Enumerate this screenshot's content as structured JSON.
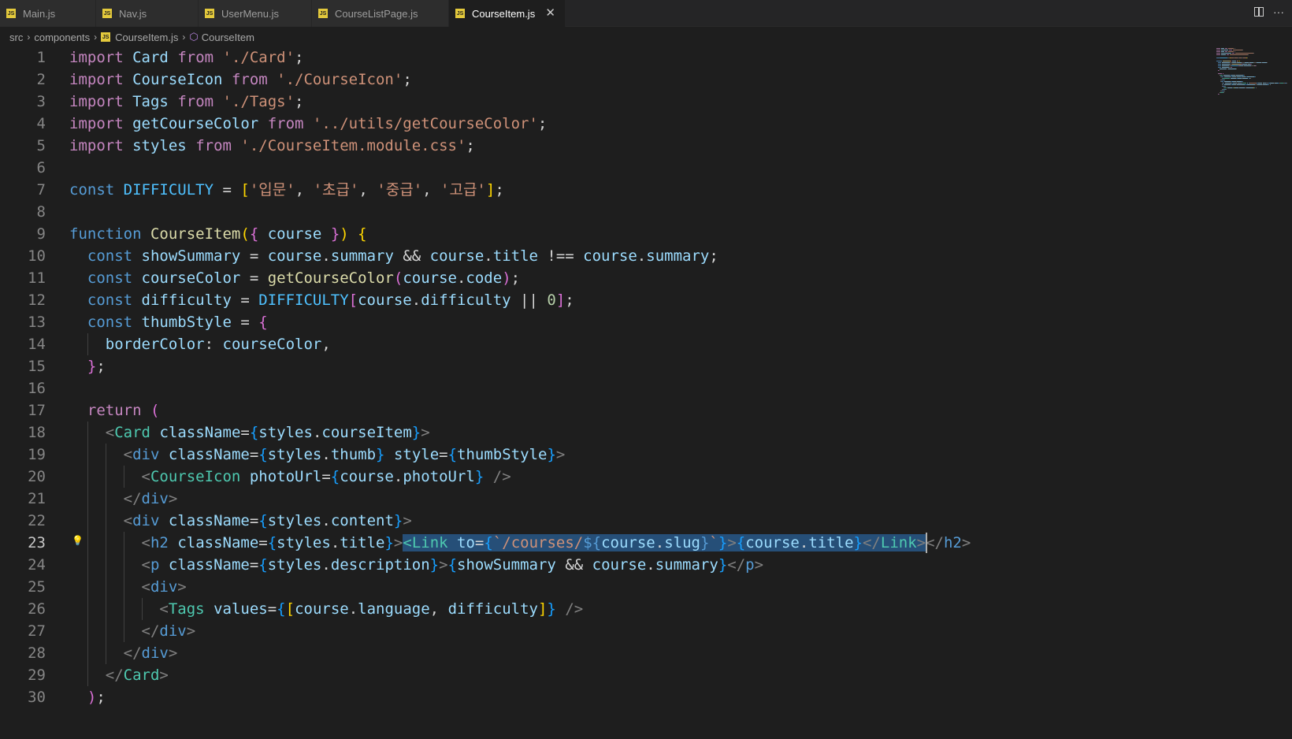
{
  "tabs": [
    {
      "label": "Main.js",
      "icon": "js-file-icon",
      "active": false
    },
    {
      "label": "Nav.js",
      "icon": "js-file-icon",
      "active": false
    },
    {
      "label": "UserMenu.js",
      "icon": "js-file-icon",
      "active": false
    },
    {
      "label": "CourseListPage.js",
      "icon": "js-file-icon",
      "active": false
    },
    {
      "label": "CourseItem.js",
      "icon": "js-file-icon",
      "active": true
    }
  ],
  "tab_icon_text": "JS",
  "close_glyph": "✕",
  "more_glyph": "···",
  "breadcrumb": {
    "items": [
      "src",
      "components",
      "CourseItem.js",
      "CourseItem"
    ],
    "sep": "›"
  },
  "active_line": 23,
  "colors": {
    "background": "#1e1e1e",
    "keyword": "#c586c0",
    "storage": "#569cd6",
    "function": "#dcdcaa",
    "variable": "#9cdcfe",
    "string": "#ce9178",
    "component": "#4ec9b0",
    "selection": "#264f78"
  },
  "code_lines": [
    {
      "n": 1,
      "tokens": [
        [
          "kw",
          "import"
        ],
        [
          "op",
          " "
        ],
        [
          "var",
          "Card"
        ],
        [
          "op",
          " "
        ],
        [
          "kw",
          "from"
        ],
        [
          "op",
          " "
        ],
        [
          "str",
          "'./Card'"
        ],
        [
          "op",
          ";"
        ]
      ]
    },
    {
      "n": 2,
      "tokens": [
        [
          "kw",
          "import"
        ],
        [
          "op",
          " "
        ],
        [
          "var",
          "CourseIcon"
        ],
        [
          "op",
          " "
        ],
        [
          "kw",
          "from"
        ],
        [
          "op",
          " "
        ],
        [
          "str",
          "'./CourseIcon'"
        ],
        [
          "op",
          ";"
        ]
      ]
    },
    {
      "n": 3,
      "tokens": [
        [
          "kw",
          "import"
        ],
        [
          "op",
          " "
        ],
        [
          "var",
          "Tags"
        ],
        [
          "op",
          " "
        ],
        [
          "kw",
          "from"
        ],
        [
          "op",
          " "
        ],
        [
          "str",
          "'./Tags'"
        ],
        [
          "op",
          ";"
        ]
      ]
    },
    {
      "n": 4,
      "tokens": [
        [
          "kw",
          "import"
        ],
        [
          "op",
          " "
        ],
        [
          "var",
          "getCourseColor"
        ],
        [
          "op",
          " "
        ],
        [
          "kw",
          "from"
        ],
        [
          "op",
          " "
        ],
        [
          "str",
          "'../utils/getCourseColor'"
        ],
        [
          "op",
          ";"
        ]
      ]
    },
    {
      "n": 5,
      "tokens": [
        [
          "kw",
          "import"
        ],
        [
          "op",
          " "
        ],
        [
          "var",
          "styles"
        ],
        [
          "op",
          " "
        ],
        [
          "kw",
          "from"
        ],
        [
          "op",
          " "
        ],
        [
          "str",
          "'./CourseItem.module.css'"
        ],
        [
          "op",
          ";"
        ]
      ]
    },
    {
      "n": 6,
      "tokens": []
    },
    {
      "n": 7,
      "tokens": [
        [
          "st",
          "const"
        ],
        [
          "op",
          " "
        ],
        [
          "con",
          "DIFFICULTY"
        ],
        [
          "op",
          " = "
        ],
        [
          "b1",
          "["
        ],
        [
          "str",
          "'입문'"
        ],
        [
          "op",
          ", "
        ],
        [
          "str",
          "'초급'"
        ],
        [
          "op",
          ", "
        ],
        [
          "str",
          "'중급'"
        ],
        [
          "op",
          ", "
        ],
        [
          "str",
          "'고급'"
        ],
        [
          "b1",
          "]"
        ],
        [
          "op",
          ";"
        ]
      ]
    },
    {
      "n": 8,
      "tokens": []
    },
    {
      "n": 9,
      "tokens": [
        [
          "st",
          "function"
        ],
        [
          "op",
          " "
        ],
        [
          "fn",
          "CourseItem"
        ],
        [
          "b1",
          "("
        ],
        [
          "b2",
          "{"
        ],
        [
          "op",
          " "
        ],
        [
          "var",
          "course"
        ],
        [
          "op",
          " "
        ],
        [
          "b2",
          "}"
        ],
        [
          "b1",
          ")"
        ],
        [
          "op",
          " "
        ],
        [
          "b1",
          "{"
        ]
      ]
    },
    {
      "n": 10,
      "tokens": [
        [
          "op",
          "  "
        ],
        [
          "st",
          "const"
        ],
        [
          "op",
          " "
        ],
        [
          "var",
          "showSummary"
        ],
        [
          "op",
          " = "
        ],
        [
          "var",
          "course"
        ],
        [
          "op",
          "."
        ],
        [
          "var",
          "summary"
        ],
        [
          "op",
          " && "
        ],
        [
          "var",
          "course"
        ],
        [
          "op",
          "."
        ],
        [
          "var",
          "title"
        ],
        [
          "op",
          " !== "
        ],
        [
          "var",
          "course"
        ],
        [
          "op",
          "."
        ],
        [
          "var",
          "summary"
        ],
        [
          "op",
          ";"
        ]
      ]
    },
    {
      "n": 11,
      "tokens": [
        [
          "op",
          "  "
        ],
        [
          "st",
          "const"
        ],
        [
          "op",
          " "
        ],
        [
          "var",
          "courseColor"
        ],
        [
          "op",
          " = "
        ],
        [
          "fn",
          "getCourseColor"
        ],
        [
          "b2",
          "("
        ],
        [
          "var",
          "course"
        ],
        [
          "op",
          "."
        ],
        [
          "var",
          "code"
        ],
        [
          "b2",
          ")"
        ],
        [
          "op",
          ";"
        ]
      ]
    },
    {
      "n": 12,
      "tokens": [
        [
          "op",
          "  "
        ],
        [
          "st",
          "const"
        ],
        [
          "op",
          " "
        ],
        [
          "var",
          "difficulty"
        ],
        [
          "op",
          " = "
        ],
        [
          "con",
          "DIFFICULTY"
        ],
        [
          "b2",
          "["
        ],
        [
          "var",
          "course"
        ],
        [
          "op",
          "."
        ],
        [
          "var",
          "difficulty"
        ],
        [
          "op",
          " || "
        ],
        [
          "num",
          "0"
        ],
        [
          "b2",
          "]"
        ],
        [
          "op",
          ";"
        ]
      ]
    },
    {
      "n": 13,
      "tokens": [
        [
          "op",
          "  "
        ],
        [
          "st",
          "const"
        ],
        [
          "op",
          " "
        ],
        [
          "var",
          "thumbStyle"
        ],
        [
          "op",
          " = "
        ],
        [
          "b2",
          "{"
        ]
      ]
    },
    {
      "n": 14,
      "tokens": [
        [
          "op",
          "    "
        ],
        [
          "var",
          "borderColor"
        ],
        [
          "op",
          ": "
        ],
        [
          "var",
          "courseColor"
        ],
        [
          "op",
          ","
        ]
      ]
    },
    {
      "n": 15,
      "tokens": [
        [
          "op",
          "  "
        ],
        [
          "b2",
          "}"
        ],
        [
          "op",
          ";"
        ]
      ]
    },
    {
      "n": 16,
      "tokens": []
    },
    {
      "n": 17,
      "tokens": [
        [
          "op",
          "  "
        ],
        [
          "kw",
          "return"
        ],
        [
          "op",
          " "
        ],
        [
          "b2",
          "("
        ]
      ]
    },
    {
      "n": 18,
      "tokens": [
        [
          "op",
          "    "
        ],
        [
          "tagp",
          "<"
        ],
        [
          "comp",
          "Card"
        ],
        [
          "op",
          " "
        ],
        [
          "attr",
          "className"
        ],
        [
          "op",
          "="
        ],
        [
          "b3",
          "{"
        ],
        [
          "var",
          "styles"
        ],
        [
          "op",
          "."
        ],
        [
          "var",
          "courseItem"
        ],
        [
          "b3",
          "}"
        ],
        [
          "tagp",
          ">"
        ]
      ]
    },
    {
      "n": 19,
      "tokens": [
        [
          "op",
          "      "
        ],
        [
          "tagp",
          "<"
        ],
        [
          "htag",
          "div"
        ],
        [
          "op",
          " "
        ],
        [
          "attr",
          "className"
        ],
        [
          "op",
          "="
        ],
        [
          "b3",
          "{"
        ],
        [
          "var",
          "styles"
        ],
        [
          "op",
          "."
        ],
        [
          "var",
          "thumb"
        ],
        [
          "b3",
          "}"
        ],
        [
          "op",
          " "
        ],
        [
          "attr",
          "style"
        ],
        [
          "op",
          "="
        ],
        [
          "b3",
          "{"
        ],
        [
          "var",
          "thumbStyle"
        ],
        [
          "b3",
          "}"
        ],
        [
          "tagp",
          ">"
        ]
      ]
    },
    {
      "n": 20,
      "tokens": [
        [
          "op",
          "        "
        ],
        [
          "tagp",
          "<"
        ],
        [
          "comp",
          "CourseIcon"
        ],
        [
          "op",
          " "
        ],
        [
          "attr",
          "photoUrl"
        ],
        [
          "op",
          "="
        ],
        [
          "b3",
          "{"
        ],
        [
          "var",
          "course"
        ],
        [
          "op",
          "."
        ],
        [
          "var",
          "photoUrl"
        ],
        [
          "b3",
          "}"
        ],
        [
          "op",
          " "
        ],
        [
          "tagp",
          "/>"
        ]
      ]
    },
    {
      "n": 21,
      "tokens": [
        [
          "op",
          "      "
        ],
        [
          "tagp",
          "</"
        ],
        [
          "htag",
          "div"
        ],
        [
          "tagp",
          ">"
        ]
      ]
    },
    {
      "n": 22,
      "tokens": [
        [
          "op",
          "      "
        ],
        [
          "tagp",
          "<"
        ],
        [
          "htag",
          "div"
        ],
        [
          "op",
          " "
        ],
        [
          "attr",
          "className"
        ],
        [
          "op",
          "="
        ],
        [
          "b3",
          "{"
        ],
        [
          "var",
          "styles"
        ],
        [
          "op",
          "."
        ],
        [
          "var",
          "content"
        ],
        [
          "b3",
          "}"
        ],
        [
          "tagp",
          ">"
        ]
      ]
    },
    {
      "n": 23,
      "tokens": [
        [
          "op",
          "        "
        ],
        [
          "tagp",
          "<"
        ],
        [
          "htag",
          "h2"
        ],
        [
          "op",
          " "
        ],
        [
          "attr",
          "className"
        ],
        [
          "op",
          "="
        ],
        [
          "b3",
          "{"
        ],
        [
          "var",
          "styles"
        ],
        [
          "op",
          "."
        ],
        [
          "var",
          "title"
        ],
        [
          "b3",
          "}"
        ],
        [
          "tagp",
          ">"
        ],
        [
          "comp",
          "<Link",
          1
        ],
        [
          "op",
          " ",
          1
        ],
        [
          "attr",
          "to",
          1
        ],
        [
          "op",
          "=",
          1
        ],
        [
          "b3",
          "{",
          1
        ],
        [
          "str",
          "`/courses/",
          1
        ],
        [
          "st",
          "${",
          1
        ],
        [
          "var",
          "course",
          1
        ],
        [
          "op",
          ".",
          1
        ],
        [
          "var",
          "slug",
          1
        ],
        [
          "st",
          "}",
          1
        ],
        [
          "str",
          "`",
          1
        ],
        [
          "b3",
          "}",
          1
        ],
        [
          "tagp",
          ">",
          1
        ],
        [
          "b3",
          "{",
          1
        ],
        [
          "var",
          "course",
          1
        ],
        [
          "op",
          ".",
          1
        ],
        [
          "var",
          "title",
          1
        ],
        [
          "b3",
          "}",
          1
        ],
        [
          "tagp",
          "</",
          1
        ],
        [
          "comp",
          "Link",
          1
        ],
        [
          "tagp",
          ">",
          1
        ],
        [
          "tagp",
          "</"
        ],
        [
          "htag",
          "h2"
        ],
        [
          "tagp",
          ">"
        ]
      ]
    },
    {
      "n": 24,
      "tokens": [
        [
          "op",
          "        "
        ],
        [
          "tagp",
          "<"
        ],
        [
          "htag",
          "p"
        ],
        [
          "op",
          " "
        ],
        [
          "attr",
          "className"
        ],
        [
          "op",
          "="
        ],
        [
          "b3",
          "{"
        ],
        [
          "var",
          "styles"
        ],
        [
          "op",
          "."
        ],
        [
          "var",
          "description"
        ],
        [
          "b3",
          "}"
        ],
        [
          "tagp",
          ">"
        ],
        [
          "b3",
          "{"
        ],
        [
          "var",
          "showSummary"
        ],
        [
          "op",
          " && "
        ],
        [
          "var",
          "course"
        ],
        [
          "op",
          "."
        ],
        [
          "var",
          "summary"
        ],
        [
          "b3",
          "}"
        ],
        [
          "tagp",
          "</"
        ],
        [
          "htag",
          "p"
        ],
        [
          "tagp",
          ">"
        ]
      ]
    },
    {
      "n": 25,
      "tokens": [
        [
          "op",
          "        "
        ],
        [
          "tagp",
          "<"
        ],
        [
          "htag",
          "div"
        ],
        [
          "tagp",
          ">"
        ]
      ]
    },
    {
      "n": 26,
      "tokens": [
        [
          "op",
          "          "
        ],
        [
          "tagp",
          "<"
        ],
        [
          "comp",
          "Tags"
        ],
        [
          "op",
          " "
        ],
        [
          "attr",
          "values"
        ],
        [
          "op",
          "="
        ],
        [
          "b3",
          "{"
        ],
        [
          "b1",
          "["
        ],
        [
          "var",
          "course"
        ],
        [
          "op",
          "."
        ],
        [
          "var",
          "language"
        ],
        [
          "op",
          ", "
        ],
        [
          "var",
          "difficulty"
        ],
        [
          "b1",
          "]"
        ],
        [
          "b3",
          "}"
        ],
        [
          "op",
          " "
        ],
        [
          "tagp",
          "/>"
        ]
      ]
    },
    {
      "n": 27,
      "tokens": [
        [
          "op",
          "        "
        ],
        [
          "tagp",
          "</"
        ],
        [
          "htag",
          "div"
        ],
        [
          "tagp",
          ">"
        ]
      ]
    },
    {
      "n": 28,
      "tokens": [
        [
          "op",
          "      "
        ],
        [
          "tagp",
          "</"
        ],
        [
          "htag",
          "div"
        ],
        [
          "tagp",
          ">"
        ]
      ]
    },
    {
      "n": 29,
      "tokens": [
        [
          "op",
          "    "
        ],
        [
          "tagp",
          "</"
        ],
        [
          "comp",
          "Card"
        ],
        [
          "tagp",
          ">"
        ]
      ]
    },
    {
      "n": 30,
      "tokens": [
        [
          "op",
          "  "
        ],
        [
          "b2",
          ")"
        ],
        [
          "op",
          ";"
        ]
      ]
    }
  ]
}
